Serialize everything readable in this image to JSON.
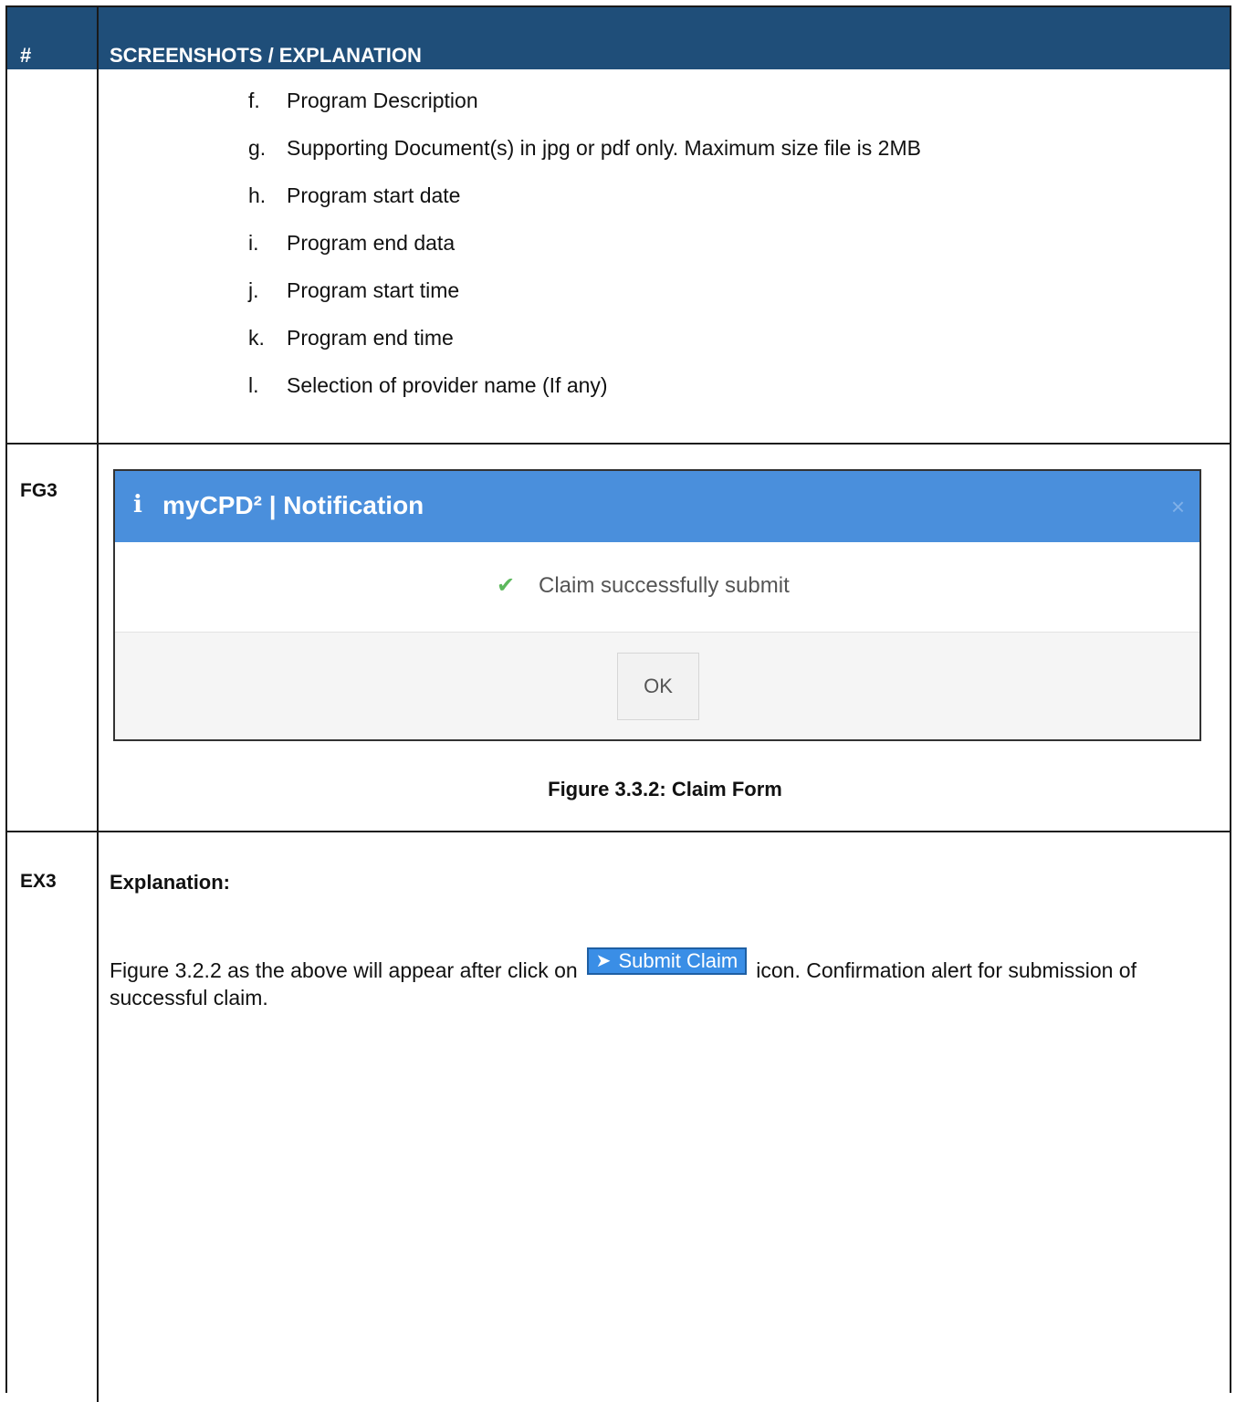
{
  "header": {
    "num_label": "#",
    "title": "SCREENSHOTS / EXPLANATION"
  },
  "list_items": [
    {
      "marker": "f.",
      "text": "Program Description"
    },
    {
      "marker": "g.",
      "text": "Supporting Document(s) in jpg or pdf only. Maximum size file is 2MB"
    },
    {
      "marker": "h.",
      "text": "Program start date"
    },
    {
      "marker": "i.",
      "text": "Program end data"
    },
    {
      "marker": "j.",
      "text": "Program start time"
    },
    {
      "marker": "k.",
      "text": "Program end time"
    },
    {
      "marker": "l.",
      "text": "Selection of provider name (If any)"
    }
  ],
  "fg3": {
    "label": "FG3",
    "dialog": {
      "info_icon": "info-icon",
      "title": "myCPD² | Notification",
      "close_icon": "close-icon",
      "message": "Claim successfully submit",
      "check_icon": "check-icon",
      "ok_label": "OK",
      "header_color": "#4a8fdc",
      "check_color": "#5cb85c"
    },
    "caption": "Figure 3.3.2: Claim Form"
  },
  "ex3": {
    "label": "EX3",
    "title": "Explanation:",
    "text_before": "Figure 3.2.2 as the above will appear after click on",
    "submit_button_label": "Submit Claim",
    "submit_icon": "paper-plane-icon",
    "text_after": "icon. Confirmation alert for submission of successful claim."
  },
  "colors": {
    "header_bg": "#1f4e79",
    "submit_button_bg": "#3a8ee6"
  }
}
